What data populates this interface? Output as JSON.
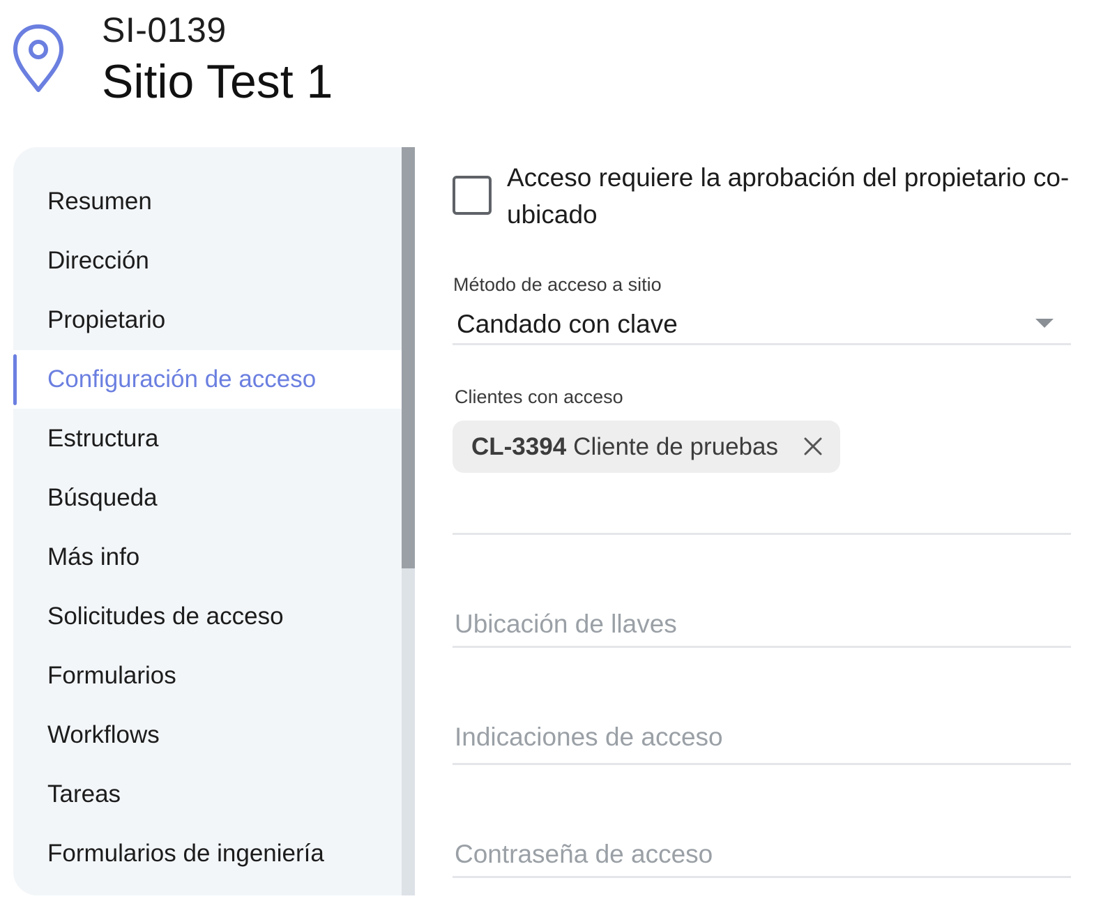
{
  "header": {
    "icon": "location-pin-icon",
    "site_code": "SI-0139",
    "site_name": "Sitio Test 1"
  },
  "sidebar": {
    "active_index": 3,
    "items": [
      {
        "label": "Resumen"
      },
      {
        "label": "Dirección"
      },
      {
        "label": "Propietario"
      },
      {
        "label": "Configuración de acceso"
      },
      {
        "label": "Estructura"
      },
      {
        "label": "Búsqueda"
      },
      {
        "label": "Más info"
      },
      {
        "label": "Solicitudes de acceso"
      },
      {
        "label": "Formularios"
      },
      {
        "label": "Workflows"
      },
      {
        "label": "Tareas"
      },
      {
        "label": "Formularios de ingeniería"
      }
    ]
  },
  "form": {
    "owner_approval": {
      "label": "Acceso requiere la aprobación del propietario co-ubicado",
      "checked": false
    },
    "access_method": {
      "label": "Método de acceso a sitio",
      "value": "Candado con clave"
    },
    "clients": {
      "label": "Clientes con acceso",
      "chips": [
        {
          "code": "CL-3394",
          "name": "Cliente de pruebas"
        }
      ]
    },
    "key_location": {
      "placeholder": "Ubicación de llaves"
    },
    "access_directions": {
      "placeholder": "Indicaciones de acceso"
    },
    "access_password": {
      "placeholder": "Contraseña de acceso"
    }
  },
  "colors": {
    "accent": "#6b7fe0",
    "sidebar_bg": "#f3f6f9",
    "chip_bg": "#eeeeee",
    "placeholder": "#9aa0a6"
  }
}
